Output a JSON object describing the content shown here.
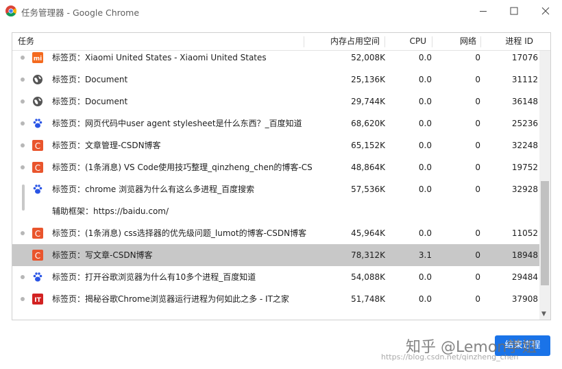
{
  "window": {
    "title": "任务管理器 - Google Chrome",
    "buttons": {
      "minimize": "minimize-icon",
      "maximize": "maximize-icon",
      "close": "close-icon"
    }
  },
  "table": {
    "headers": {
      "task": "任务",
      "memory": "内存占用空间",
      "cpu": "CPU",
      "network": "网络",
      "pid": "进程 ID"
    },
    "rows": [
      {
        "icon": "xiaomi-icon",
        "label": "标签页：Xiaomi United States - Xiaomi United States",
        "memory": "52,008K",
        "cpu": "0.0",
        "network": "0",
        "pid": "17076"
      },
      {
        "icon": "globe-icon",
        "label": "标签页：Document",
        "memory": "25,136K",
        "cpu": "0.0",
        "network": "0",
        "pid": "31112"
      },
      {
        "icon": "globe-icon",
        "label": "标签页：Document",
        "memory": "29,744K",
        "cpu": "0.0",
        "network": "0",
        "pid": "36148"
      },
      {
        "icon": "baidu-paw-icon",
        "label": "标签页：网页代码中user agent stylesheet是什么东西？_百度知道",
        "memory": "68,620K",
        "cpu": "0.0",
        "network": "0",
        "pid": "25236"
      },
      {
        "icon": "csdn-icon",
        "label": "标签页：文章管理-CSDN博客",
        "memory": "65,152K",
        "cpu": "0.0",
        "network": "0",
        "pid": "32248"
      },
      {
        "icon": "csdn-icon",
        "label": "标签页：(1条消息) VS Code使用技巧整理_qinzheng_chen的博客-CS...",
        "memory": "48,864K",
        "cpu": "0.0",
        "network": "0",
        "pid": "19752"
      },
      {
        "icon": "baidu-paw-icon",
        "label": "标签页：chrome 浏览器为什么有这么多进程_百度搜索",
        "memory": "57,536K",
        "cpu": "0.0",
        "network": "0",
        "pid": "32928"
      },
      {
        "icon": "",
        "label": "辅助框架：https://baidu.com/",
        "memory": "",
        "cpu": "",
        "network": "",
        "pid": ""
      },
      {
        "icon": "csdn-icon",
        "label": "标签页：(1条消息) css选择器的优先级问题_lumot的博客-CSDN博客",
        "memory": "45,964K",
        "cpu": "0.0",
        "network": "0",
        "pid": "11052"
      },
      {
        "icon": "csdn-icon",
        "label": "标签页：写文章-CSDN博客",
        "memory": "78,312K",
        "cpu": "3.1",
        "network": "0",
        "pid": "18948"
      },
      {
        "icon": "baidu-paw-icon",
        "label": "标签页：打开谷歌浏览器为什么有10多个进程_百度知道",
        "memory": "54,088K",
        "cpu": "0.0",
        "network": "0",
        "pid": "29484"
      },
      {
        "icon": "ithome-icon",
        "label": "标签页：揭秘谷歌Chrome浏览器运行进程为何如此之多 - IT之家",
        "memory": "51,748K",
        "cpu": "0.0",
        "network": "0",
        "pid": "37908"
      }
    ]
  },
  "end_button": "结束进程",
  "watermark": {
    "line1": "知乎 @Lemon学姐",
    "line2": "https://blog.csdn.net/qinzheng_chen"
  },
  "colors": {
    "selected_row": "#c8c8c8",
    "csdn": "#e9552d",
    "xiaomi": "#f46a1f",
    "baidu": "#2a55e5",
    "ithome": "#d22222",
    "button": "#1a73e8"
  }
}
